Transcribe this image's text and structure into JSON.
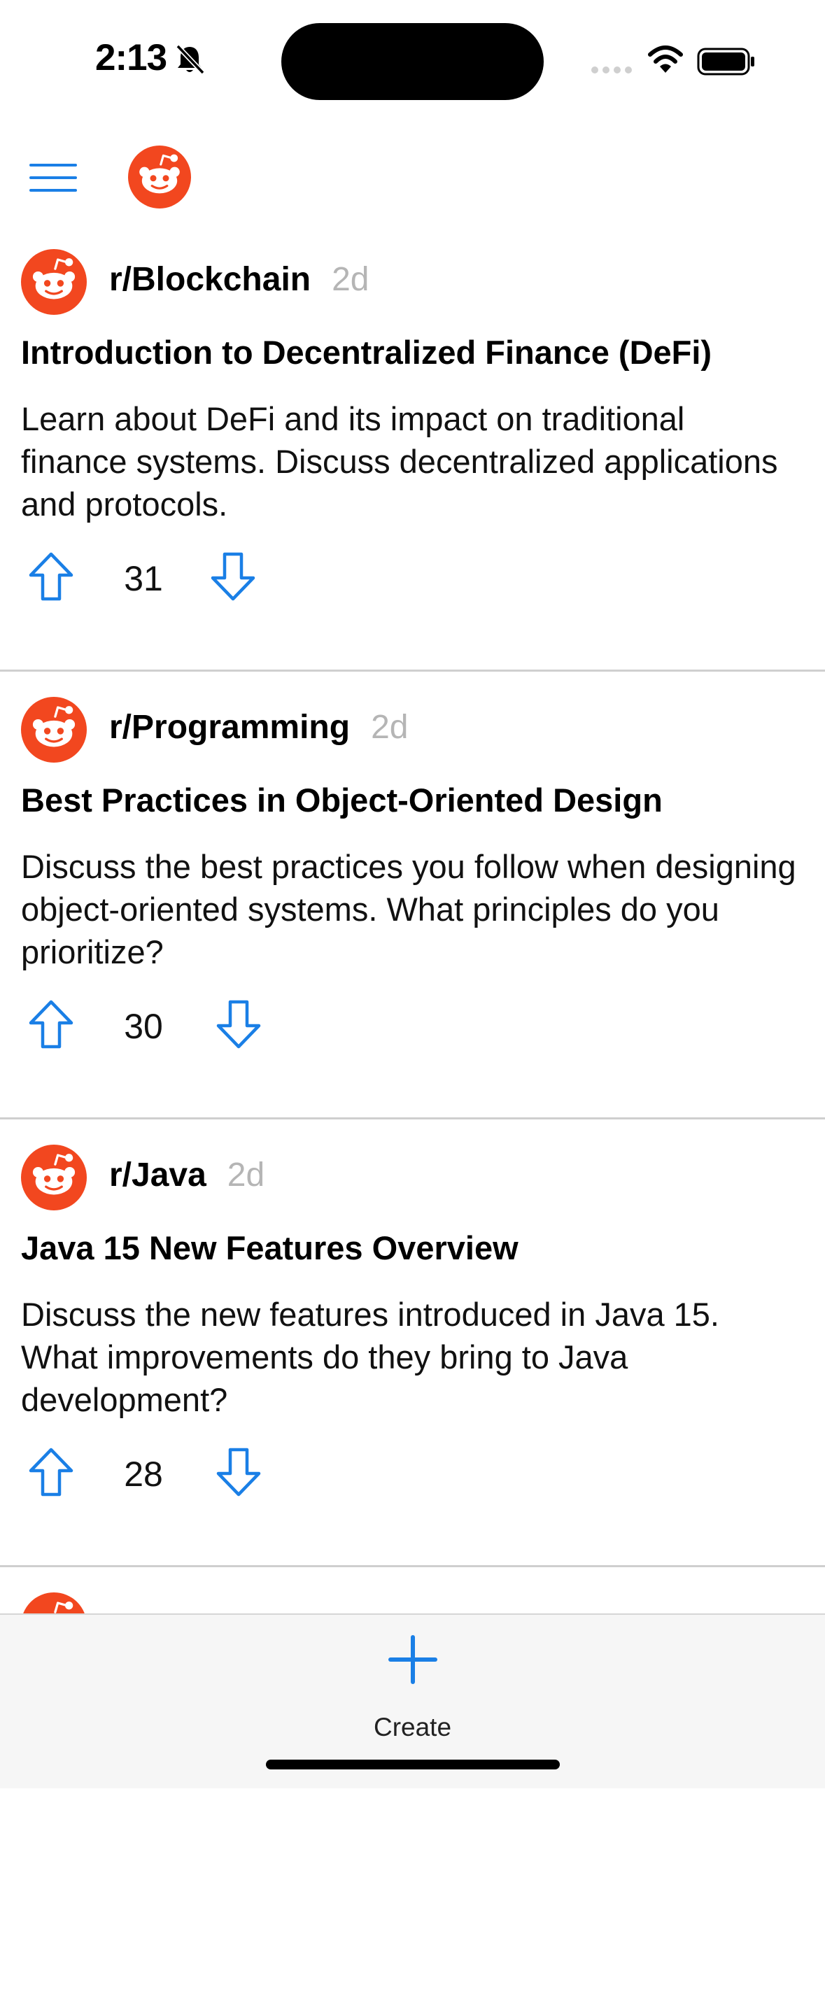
{
  "status_bar": {
    "time": "2:13",
    "icons": [
      "bell-slash-icon",
      "signal-icon",
      "wifi-icon",
      "battery-icon"
    ]
  },
  "nav": {
    "icons": [
      "menu-icon",
      "reddit-logo-icon"
    ]
  },
  "colors": {
    "accent": "#1a7fe6",
    "brand": "#f2471f",
    "muted": "#b5b5b5",
    "divider": "#cfcfcf"
  },
  "posts": [
    {
      "subreddit": "r/Blockchain",
      "age": "2d",
      "title": "Introduction to Decentralized Finance (DeFi)",
      "body": "Learn about DeFi and its impact on traditional finance systems. Discuss decentralized applications and protocols.",
      "score": "31"
    },
    {
      "subreddit": "r/Programming",
      "age": "2d",
      "title": "Best Practices in Object-Oriented Design",
      "body": "Discuss the best practices you follow when designing object-oriented systems. What principles do you prioritize?",
      "score": "30"
    },
    {
      "subreddit": "r/Java",
      "age": "2d",
      "title": "Java 15 New Features Overview",
      "body": "Discuss the new features introduced in Java 15. What improvements do they bring to Java development?",
      "score": "28"
    }
  ],
  "tab_bar": {
    "create_label": "Create",
    "create_icon": "plus-icon"
  }
}
